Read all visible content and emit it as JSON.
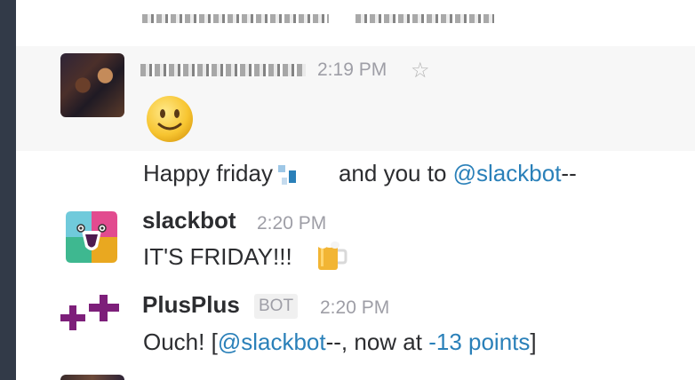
{
  "messages": [
    {
      "time": "2:19 PM",
      "emoji": "slightly-smiling-face",
      "star_icon": "star-icon"
    },
    {
      "text_prefix": "Happy friday",
      "text_middle": "and you to",
      "mention": "@slackbot",
      "suffix": "--"
    },
    {
      "name": "slackbot",
      "time": "2:20 PM",
      "text": "IT'S FRIDAY!!!",
      "emoji": "beer-mug"
    },
    {
      "name": "PlusPlus",
      "badge": "BOT",
      "time": "2:20 PM",
      "text_prefix": "Ouch! [",
      "mention": "@slackbot",
      "text_mid": "--, now at ",
      "points": "-13 points",
      "text_suffix": "]"
    }
  ],
  "colors": {
    "rail": "#323a48",
    "mention": "#2a80b9",
    "name": "#2c2d30",
    "time": "#9e9ea6",
    "plusplus_purple": "#7d1f7a"
  }
}
